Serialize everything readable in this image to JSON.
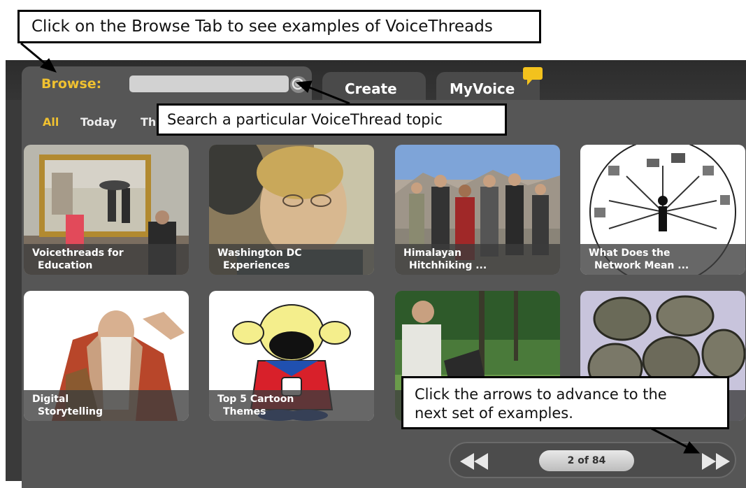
{
  "tabs": {
    "browse_label": "Browse:",
    "create_label": "Create",
    "myvoice_label": "MyVoice"
  },
  "search": {
    "placeholder": ""
  },
  "filters": [
    "All",
    "Today",
    "Th"
  ],
  "cards": [
    {
      "line1": "Voicethreads for",
      "line2": "Education"
    },
    {
      "line1": "Washington DC",
      "line2": "Experiences"
    },
    {
      "line1": "Himalayan",
      "line2": "Hitchhiking ..."
    },
    {
      "line1": "What Does the",
      "line2": "Network Mean ..."
    },
    {
      "line1": "Digital",
      "line2": "Storytelling"
    },
    {
      "line1": "Top 5 Cartoon",
      "line2": "Themes"
    },
    {
      "line1": "",
      "line2": ""
    },
    {
      "line1": "",
      "line2": ""
    }
  ],
  "pager": {
    "label": "2 of 84"
  },
  "callouts": {
    "top": "Click on the Browse Tab to see examples of VoiceThreads",
    "search": "Search a particular VoiceThread topic",
    "arrows_line1": "Click the arrows to advance to the",
    "arrows_line2": "next set of examples."
  },
  "colors": {
    "accent": "#f0c130",
    "panel": "#565656",
    "background": "#3a3a3a"
  }
}
